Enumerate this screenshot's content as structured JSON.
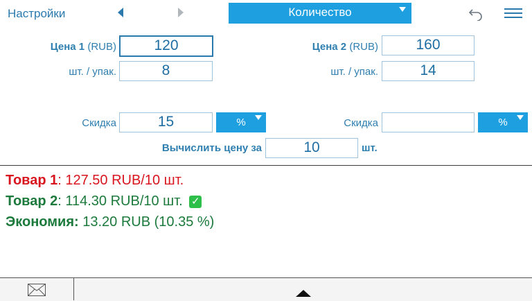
{
  "topbar": {
    "settings_label": "Настройки",
    "mode_select_value": "Количество",
    "icons": {
      "back": "chevron-left-icon",
      "forward": "chevron-right-icon",
      "undo": "undo-icon",
      "menu": "menu-icon"
    }
  },
  "item1": {
    "price_label_bold": "Цена 1",
    "price_label_unit": "(RUB)",
    "price_value": "120",
    "pack_label": "шт. / упак.",
    "pack_value": "8",
    "discount_label": "Скидка",
    "discount_value": "15",
    "discount_unit": "%"
  },
  "item2": {
    "price_label_bold": "Цена 2",
    "price_label_unit": "(RUB)",
    "price_value": "160",
    "pack_label": "шт. / упак.",
    "pack_value": "14",
    "discount_label": "Скидка",
    "discount_value": "",
    "discount_unit": "%"
  },
  "compute": {
    "label": "Вычислить цену за",
    "value": "10",
    "unit": "шт."
  },
  "results": {
    "item1_label": "Товар 1",
    "item1_text": ": 127.50 RUB/10 шт.",
    "item2_label": "Товар 2",
    "item2_text": ": 114.30 RUB/10 шт.",
    "check_mark": "✓",
    "savings_label": "Экономия:",
    "savings_text": " 13.20 RUB (10.35 %)"
  },
  "colors": {
    "accent": "#1d9fe0",
    "label_blue": "#2f7fb0",
    "red": "#d8151e",
    "green": "#1c7a3c"
  }
}
